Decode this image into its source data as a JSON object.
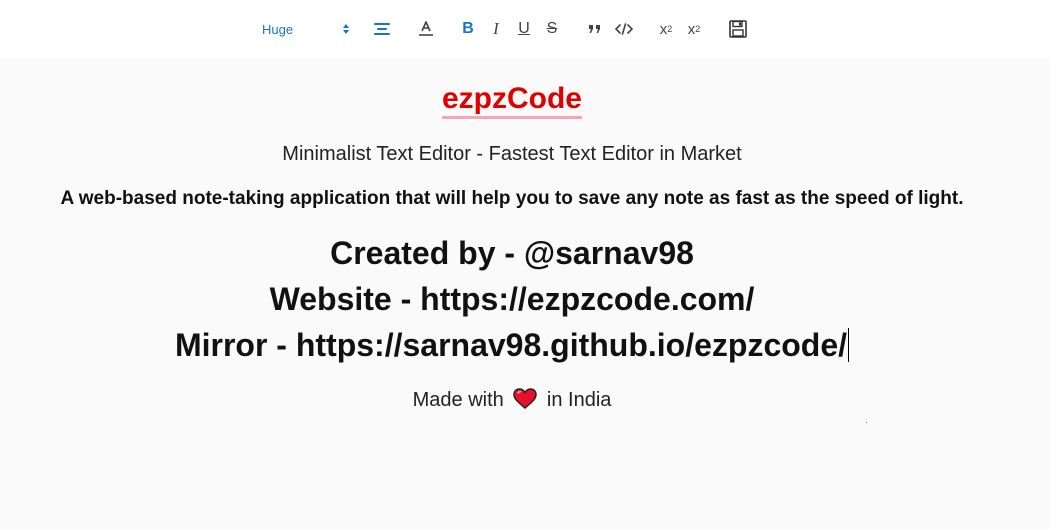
{
  "toolbar": {
    "font_size_value": "Huge",
    "bold_label": "B",
    "italic_label": "I",
    "underline_label": "U",
    "strike_label": "S",
    "subscript_label": "x",
    "subscript_mark": "2",
    "superscript_label": "x",
    "superscript_mark": "2"
  },
  "document": {
    "title": "ezpzCode",
    "subtitle": "Minimalist Text Editor - Fastest Text Editor in Market",
    "description": "A web-based note-taking application that will help you to save any note as fast as the speed of light.",
    "created_by": "Created by - @sarnav98",
    "website": "Website - https://ezpzcode.com/",
    "mirror": "Mirror - https://sarnav98.github.io/ezpzcode/",
    "made_with_prefix": "Made with",
    "made_with_suffix": "in India"
  },
  "colors": {
    "title": "#e00000",
    "accent_blue": "#1a73c9",
    "heart": "#e8112d"
  },
  "icons": [
    "align-center-icon",
    "text-color-icon",
    "quote-icon",
    "code-icon",
    "save-icon",
    "heart-icon"
  ]
}
